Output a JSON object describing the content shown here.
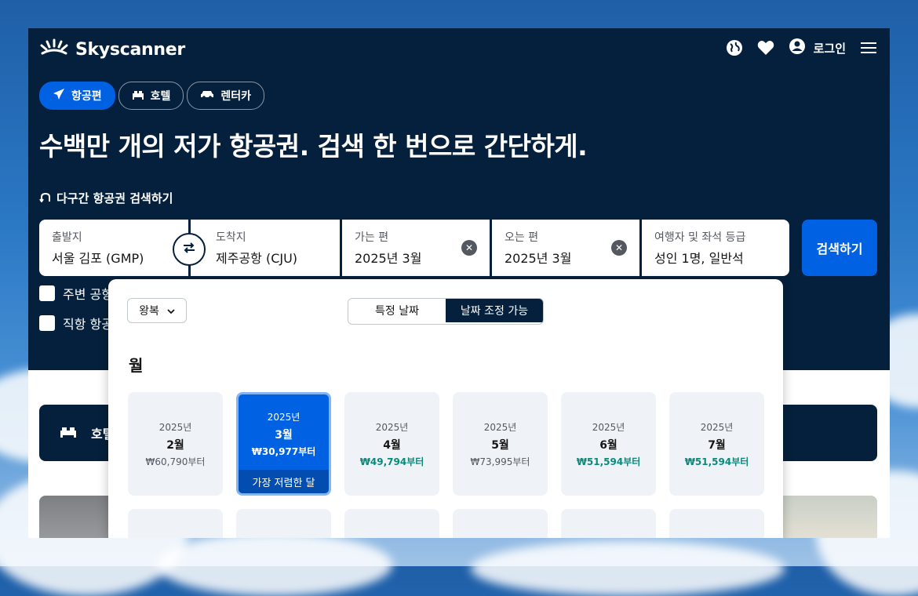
{
  "brand": {
    "name": "Skyscanner"
  },
  "header": {
    "login_label": "로그인"
  },
  "tabs": [
    {
      "label": "항공편",
      "icon": "plane-icon",
      "active": true
    },
    {
      "label": "호텔",
      "icon": "bed-icon",
      "active": false
    },
    {
      "label": "렌터카",
      "icon": "car-icon",
      "active": false
    }
  ],
  "hero": {
    "headline": "수백만 개의 저가 항공권. 검색 한 번으로 간단하게.",
    "multicity_label": "다구간 항공권 검색하기"
  },
  "search": {
    "origin": {
      "label": "출발지",
      "value": "서울 김포 (GMP)"
    },
    "destination": {
      "label": "도착지",
      "value": "제주공항 (CJU)"
    },
    "depart": {
      "label": "가는 편",
      "value": "2025년 3월"
    },
    "return": {
      "label": "오는 편",
      "value": "2025년 3월"
    },
    "travellers": {
      "label": "여행자 및 좌석 등급",
      "value": "성인 1명, 일반석"
    },
    "button_label": "검색하기"
  },
  "options": {
    "nearby_airports_label": "주변 공항",
    "direct_flights_label": "직항 항공"
  },
  "hotel_banner": {
    "label": "호텔"
  },
  "calendar_popup": {
    "trip_type": "왕복",
    "segments": {
      "specific": "특정 날짜",
      "flexible": "날짜 조정 가능"
    },
    "month_heading": "월",
    "months": [
      {
        "year": "2025년",
        "month": "2월",
        "price": "₩60,790부터",
        "style": "default"
      },
      {
        "year": "2025년",
        "month": "3월",
        "price": "₩30,977부터",
        "style": "selected",
        "tag": "가장 저렴한 달"
      },
      {
        "year": "2025년",
        "month": "4월",
        "price": "₩49,794부터",
        "style": "green"
      },
      {
        "year": "2025년",
        "month": "5월",
        "price": "₩73,995부터",
        "style": "default"
      },
      {
        "year": "2025년",
        "month": "6월",
        "price": "₩51,594부터",
        "style": "green"
      },
      {
        "year": "2025년",
        "month": "7월",
        "price": "₩51,594부터",
        "style": "green"
      }
    ]
  },
  "colors": {
    "navy": "#05203c",
    "primary_blue": "#0062e3",
    "green_price": "#0a8a7a",
    "card_bg": "#eff3f8"
  }
}
